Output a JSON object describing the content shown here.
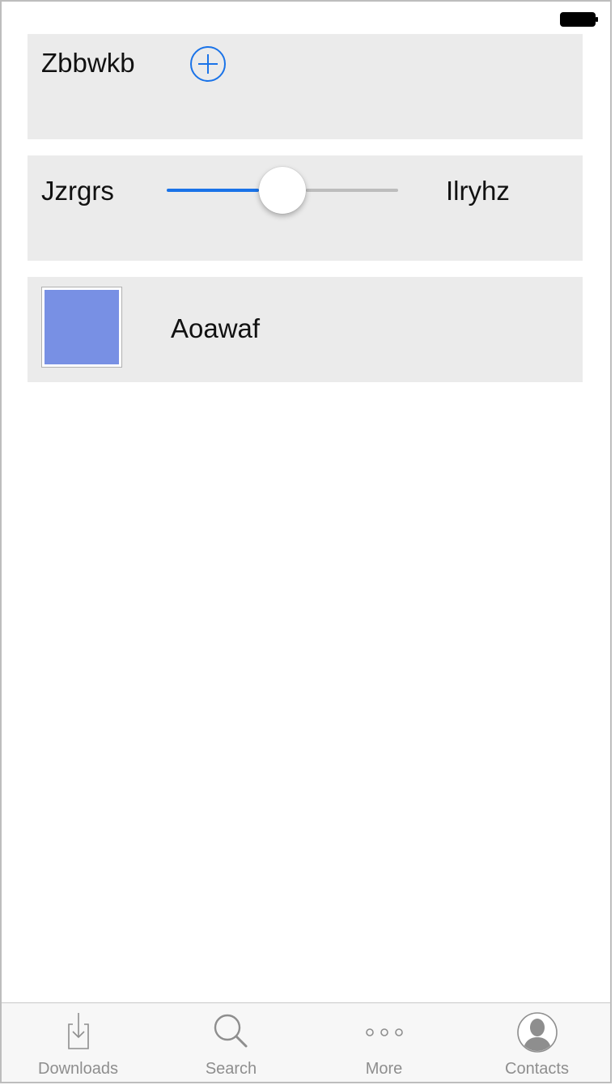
{
  "status_bar": {
    "battery_icon": "battery-full-icon"
  },
  "rows": {
    "stepper_row": {
      "label": "Zbbwkb",
      "add_icon": "plus-circle-icon",
      "accent_color": "#1a73e8"
    },
    "slider_row": {
      "label_left": "Jzrgrs",
      "label_right": "Ilryhz",
      "value": 0.5,
      "min_track_color": "#1a73e8",
      "max_track_color": "#bdbdbd"
    },
    "color_row": {
      "label": "Aoawaf",
      "swatch_color": "#7890e4"
    }
  },
  "tabbar": {
    "tabs": [
      {
        "label": "Downloads",
        "icon": "download-tray-icon"
      },
      {
        "label": "Search",
        "icon": "magnifier-icon"
      },
      {
        "label": "More",
        "icon": "more-dots-icon"
      },
      {
        "label": "Contacts",
        "icon": "person-circle-icon"
      }
    ]
  }
}
